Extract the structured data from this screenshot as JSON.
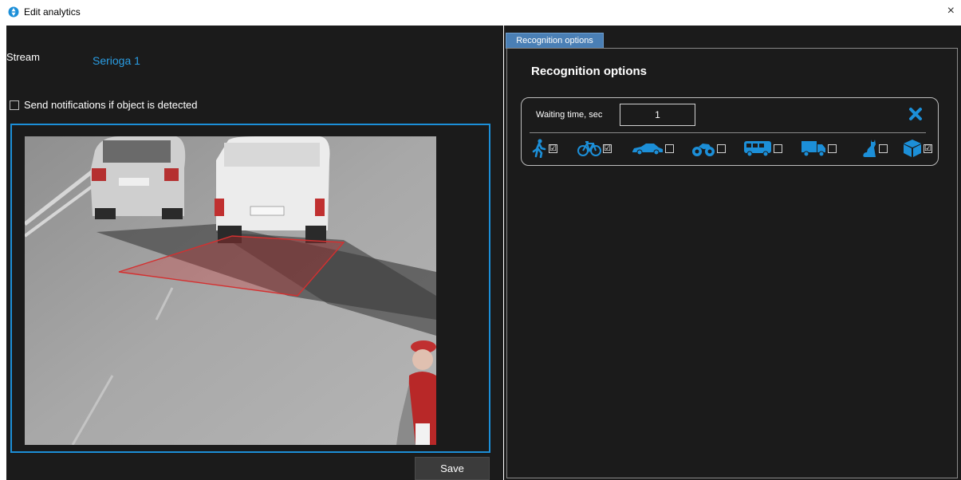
{
  "window": {
    "title": "Edit analytics",
    "close_glyph": "×"
  },
  "stream": {
    "label": "Stream",
    "value": "Serioga 1"
  },
  "notify": {
    "label": "Send notifications if object is detected",
    "checked": false
  },
  "save_label": "Save",
  "tab_label": "Recognition options",
  "panel_title": "Recognition options",
  "waiting": {
    "label": "Waiting time, sec",
    "value": "1"
  },
  "objects": [
    {
      "name": "person",
      "icon": "person-icon",
      "checked": true,
      "mark": "☑"
    },
    {
      "name": "bicycle",
      "icon": "bicycle-icon",
      "checked": true,
      "mark": "☑"
    },
    {
      "name": "car",
      "icon": "car-icon",
      "checked": false,
      "mark": ""
    },
    {
      "name": "motorcycle",
      "icon": "motorcycle-icon",
      "checked": false,
      "mark": ""
    },
    {
      "name": "bus",
      "icon": "bus-icon",
      "checked": false,
      "mark": ""
    },
    {
      "name": "truck",
      "icon": "truck-icon",
      "checked": false,
      "mark": ""
    },
    {
      "name": "animal",
      "icon": "cat-icon",
      "checked": false,
      "mark": ""
    },
    {
      "name": "other",
      "icon": "box-icon",
      "checked": true,
      "mark": "☑"
    }
  ],
  "colors": {
    "accent": "#1c8fd8",
    "link": "#2a9ee5",
    "background": "#1b1b1b",
    "zone": "#d43030"
  }
}
